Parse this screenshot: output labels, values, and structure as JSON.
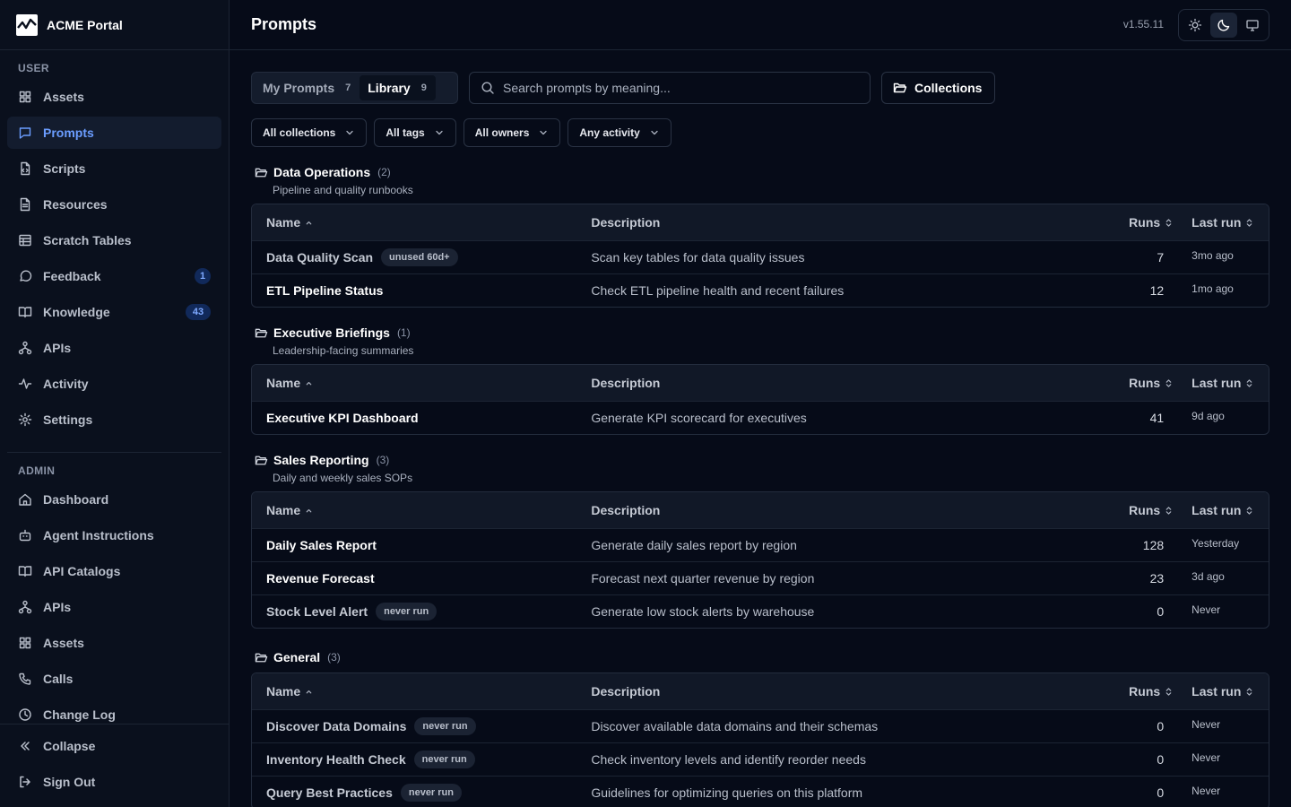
{
  "brand": {
    "name": "ACME Portal"
  },
  "sidebar": {
    "user_label": "USER",
    "user_items": [
      {
        "label": "Assets",
        "icon": "grid-icon"
      },
      {
        "label": "Prompts",
        "icon": "message-square-icon",
        "active": true
      },
      {
        "label": "Scripts",
        "icon": "file-code-icon"
      },
      {
        "label": "Resources",
        "icon": "file-text-icon"
      },
      {
        "label": "Scratch Tables",
        "icon": "table-icon"
      },
      {
        "label": "Feedback",
        "icon": "message-circle-icon",
        "badge": "1"
      },
      {
        "label": "Knowledge",
        "icon": "book-open-icon",
        "badge": "43"
      },
      {
        "label": "APIs",
        "icon": "network-icon"
      },
      {
        "label": "Activity",
        "icon": "activity-icon"
      },
      {
        "label": "Settings",
        "icon": "gear-icon"
      }
    ],
    "admin_label": "ADMIN",
    "admin_items": [
      {
        "label": "Dashboard",
        "icon": "home-icon"
      },
      {
        "label": "Agent Instructions",
        "icon": "bot-icon"
      },
      {
        "label": "API Catalogs",
        "icon": "book-open-icon"
      },
      {
        "label": "APIs",
        "icon": "network-icon"
      },
      {
        "label": "Assets",
        "icon": "grid-icon"
      },
      {
        "label": "Calls",
        "icon": "phone-icon"
      },
      {
        "label": "Change Log",
        "icon": "clock-icon"
      }
    ],
    "collapse": "Collapse",
    "sign_out": "Sign Out"
  },
  "header": {
    "title": "Prompts",
    "version": "v1.55.11",
    "themes": [
      "light",
      "dark",
      "system"
    ],
    "active_theme": "dark"
  },
  "tabs": [
    {
      "label": "My Prompts",
      "count": "7"
    },
    {
      "label": "Library",
      "count": "9",
      "active": true
    }
  ],
  "search": {
    "placeholder": "Search prompts by meaning..."
  },
  "collections_button": "Collections",
  "filters": [
    "All collections",
    "All tags",
    "All owners",
    "Any activity"
  ],
  "columns": {
    "name": "Name",
    "description": "Description",
    "runs": "Runs",
    "last_run": "Last run"
  },
  "groups": [
    {
      "name": "Data Operations",
      "count": "(2)",
      "description": "Pipeline and quality runbooks",
      "rows": [
        {
          "name": "Data Quality Scan",
          "tag": "unused 60d+",
          "description": "Scan key tables for data quality issues",
          "runs": "7",
          "last_run": "3mo ago"
        },
        {
          "name": "ETL Pipeline Status",
          "tag": "",
          "description": "Check ETL pipeline health and recent failures",
          "runs": "12",
          "last_run": "1mo ago"
        }
      ]
    },
    {
      "name": "Executive Briefings",
      "count": "(1)",
      "description": "Leadership-facing summaries",
      "rows": [
        {
          "name": "Executive KPI Dashboard",
          "tag": "",
          "description": "Generate KPI scorecard for executives",
          "runs": "41",
          "last_run": "9d ago"
        }
      ]
    },
    {
      "name": "Sales Reporting",
      "count": "(3)",
      "description": "Daily and weekly sales SOPs",
      "rows": [
        {
          "name": "Daily Sales Report",
          "tag": "",
          "description": "Generate daily sales report by region",
          "runs": "128",
          "last_run": "Yesterday"
        },
        {
          "name": "Revenue Forecast",
          "tag": "",
          "description": "Forecast next quarter revenue by region",
          "runs": "23",
          "last_run": "3d ago"
        },
        {
          "name": "Stock Level Alert",
          "tag": "never run",
          "description": "Generate low stock alerts by warehouse",
          "runs": "0",
          "last_run": "Never"
        }
      ]
    },
    {
      "name": "General",
      "count": "(3)",
      "description": "",
      "rows": [
        {
          "name": "Discover Data Domains",
          "tag": "never run",
          "description": "Discover available data domains and their schemas",
          "runs": "0",
          "last_run": "Never"
        },
        {
          "name": "Inventory Health Check",
          "tag": "never run",
          "description": "Check inventory levels and identify reorder needs",
          "runs": "0",
          "last_run": "Never"
        },
        {
          "name": "Query Best Practices",
          "tag": "never run",
          "description": "Guidelines for optimizing queries on this platform",
          "runs": "0",
          "last_run": "Never"
        }
      ]
    }
  ],
  "colors": {
    "background": "#060b18",
    "sidebar": "#0a101d",
    "accent": "#6b9dff",
    "border": "#232c3d"
  }
}
